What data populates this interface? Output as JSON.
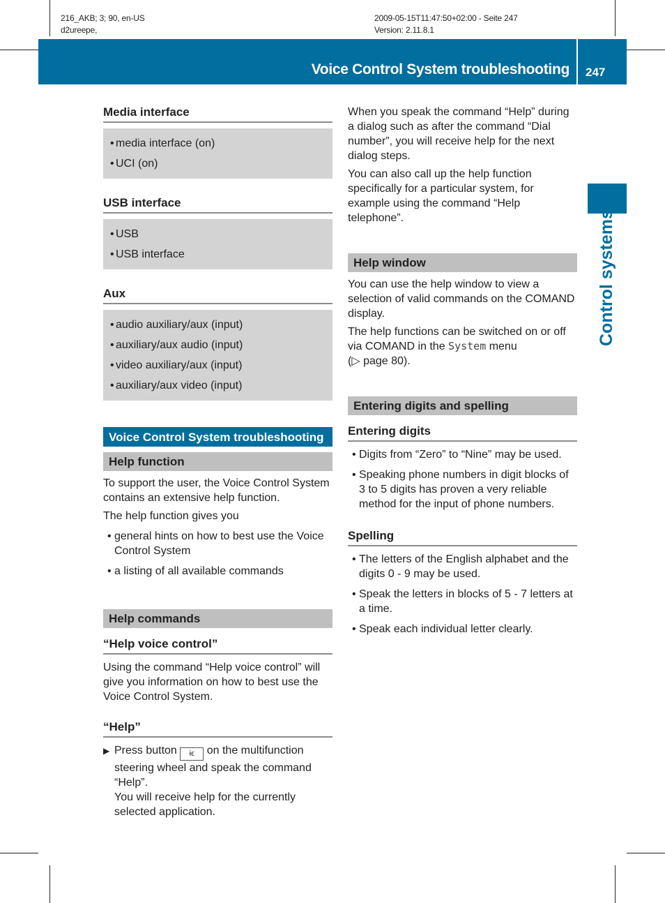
{
  "meta": {
    "left_line1": "216_AKB; 3; 90, en-US",
    "left_line2": "d2ureepe,",
    "right_line1": "2009-05-15T11:47:50+02:00 - Seite 247",
    "right_line2": "Version: 2.11.8.1"
  },
  "header": {
    "title": "Voice Control System troubleshooting",
    "page_number": "247",
    "accent_color": "#006e9e"
  },
  "side_tab": {
    "label": "Control systems"
  },
  "left": {
    "media": {
      "heading": "Media interface",
      "items": [
        "media interface (on)",
        "UCI (on)"
      ]
    },
    "usb": {
      "heading": "USB interface",
      "items": [
        "USB",
        "USB interface"
      ]
    },
    "aux": {
      "heading": "Aux",
      "items": [
        "audio auxiliary/aux (input)",
        "auxiliary/aux audio (input)",
        "video auxiliary/aux (input)",
        "auxiliary/aux video (input)"
      ]
    },
    "section_title": "Voice Control System troubleshooting",
    "help_function": {
      "heading": "Help function",
      "p1": "To support the user, the Voice Control System contains an extensive help function.",
      "p2": "The help function gives you",
      "items": [
        "general hints on how to best use the Voice Control System",
        "a listing of all available commands"
      ]
    },
    "help_commands": {
      "heading": "Help commands",
      "sub1": "“Help voice control”",
      "sub1_text": "Using the command “Help voice control” will give you information on how to best use the Voice Control System.",
      "sub2": "“Help”",
      "step_pre": "Press button",
      "step_icon": "ɨϵ",
      "step_post": "on the multifunction steering wheel and speak the command “Help”.",
      "step_result": "You will receive help for the currently selected application."
    }
  },
  "right": {
    "p1": "When you speak the command “Help” during a dialog such as after the command “Dial number”, you will receive help for the next dialog steps.",
    "p2": "You can also call up the help function specifically for a particular system, for example using the command “Help telephone”.",
    "help_window": {
      "heading": "Help window",
      "p1": "You can use the help window to view a selection of valid commands on the COMAND display.",
      "p2_pre": "The help functions can be switched on or off via COMAND in the",
      "p2_menu": "System",
      "p2_post": "menu",
      "p2_ref": "(▷ page 80)."
    },
    "digits_spelling": {
      "heading": "Entering digits and spelling",
      "digits_heading": "Entering digits",
      "digits_items": [
        "Digits from “Zero” to “Nine” may be used.",
        "Speaking phone numbers in digit blocks of 3 to 5 digits has proven a very reliable method for the input of phone numbers."
      ],
      "spelling_heading": "Spelling",
      "spelling_items": [
        "The letters of the English alphabet and the digits 0 - 9 may be used.",
        "Speak the letters in blocks of 5 - 7 letters at a time.",
        "Speak each individual letter clearly."
      ]
    }
  }
}
